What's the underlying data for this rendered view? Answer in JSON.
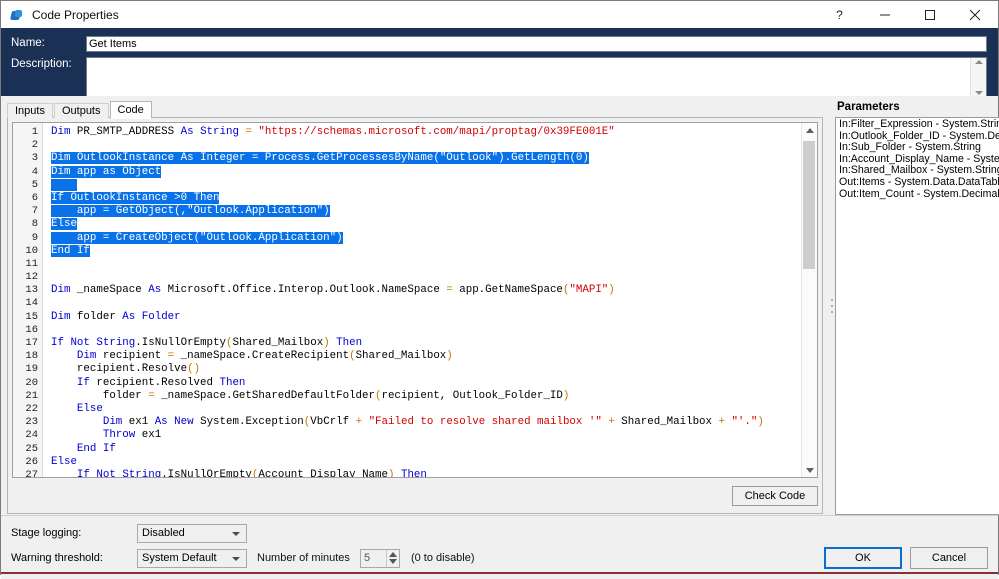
{
  "window": {
    "title": "Code Properties",
    "icon": "blueprism-app-icon",
    "controls": {
      "help": "?",
      "minimize": "minimize-icon",
      "maximize": "maximize-icon",
      "close": "close-icon"
    }
  },
  "header": {
    "name_label": "Name:",
    "name_value": "Get Items",
    "description_label": "Description:",
    "description_value": "",
    "description_placeholder": ""
  },
  "tabs": [
    {
      "label": "Inputs",
      "active": false
    },
    {
      "label": "Outputs",
      "active": false
    },
    {
      "label": "Code",
      "active": true
    }
  ],
  "editor": {
    "check_code_label": "Check Code",
    "selected_lines": [
      3,
      4,
      5,
      6,
      7,
      8,
      9,
      10
    ],
    "first_visible_line": 1,
    "last_visible_line": 27,
    "lines": [
      {
        "n": 1,
        "text": "Dim PR_SMTP_ADDRESS As String = \"https://schemas.microsoft.com/mapi/proptag/0x39FE001E\""
      },
      {
        "n": 2,
        "text": ""
      },
      {
        "n": 3,
        "text": "Dim OutlookInstance As Integer = Process.GetProcessesByName(\"Outlook\").GetLength(0)"
      },
      {
        "n": 4,
        "text": "Dim app as Object"
      },
      {
        "n": 5,
        "text": ""
      },
      {
        "n": 6,
        "text": "If OutlookInstance >0 Then"
      },
      {
        "n": 7,
        "text": "    app = GetObject(,\"Outlook.Application\")"
      },
      {
        "n": 8,
        "text": "Else"
      },
      {
        "n": 9,
        "text": "    app = CreateObject(\"Outlook.Application\")"
      },
      {
        "n": 10,
        "text": "End If"
      },
      {
        "n": 11,
        "text": ""
      },
      {
        "n": 12,
        "text": ""
      },
      {
        "n": 13,
        "text": "Dim _nameSpace As Microsoft.Office.Interop.Outlook.NameSpace = app.GetNameSpace(\"MAPI\")"
      },
      {
        "n": 14,
        "text": ""
      },
      {
        "n": 15,
        "text": "Dim folder As Folder"
      },
      {
        "n": 16,
        "text": ""
      },
      {
        "n": 17,
        "text": "If Not String.IsNullOrEmpty(Shared_Mailbox) Then"
      },
      {
        "n": 18,
        "text": "    Dim recipient = _nameSpace.CreateRecipient(Shared_Mailbox)"
      },
      {
        "n": 19,
        "text": "    recipient.Resolve()"
      },
      {
        "n": 20,
        "text": "    If recipient.Resolved Then"
      },
      {
        "n": 21,
        "text": "        folder = _nameSpace.GetSharedDefaultFolder(recipient, Outlook_Folder_ID)"
      },
      {
        "n": 22,
        "text": "    Else"
      },
      {
        "n": 23,
        "text": "        Dim ex1 As New System.Exception(VbCrlf + \"Failed to resolve shared mailbox '\" + Shared_Mailbox + \"'.\")"
      },
      {
        "n": 24,
        "text": "        Throw ex1"
      },
      {
        "n": 25,
        "text": "    End If"
      },
      {
        "n": 26,
        "text": "Else"
      },
      {
        "n": 27,
        "text": "    If Not String.IsNullOrEmpty(Account_Display_Name) Then"
      }
    ]
  },
  "parameters": {
    "title": "Parameters",
    "items": [
      "In:Filter_Expression - System.String",
      "In:Outlook_Folder_ID - System.Decimal",
      "In:Sub_Folder - System.String",
      "In:Account_Display_Name - System.String",
      "In:Shared_Mailbox - System.String",
      "Out:Items - System.Data.DataTable",
      "Out:Item_Count - System.Decimal"
    ]
  },
  "footer": {
    "stage_logging_label": "Stage logging:",
    "stage_logging_value": "Disabled",
    "warning_threshold_label": "Warning threshold:",
    "warning_threshold_value": "System Default",
    "minutes_label": "Number of minutes",
    "minutes_value": "5",
    "minutes_hint": "(0 to disable)",
    "ok_label": "OK",
    "cancel_label": "Cancel"
  },
  "colors": {
    "header_bg": "#1b3055",
    "selection_blue": "#0a72e8",
    "keyword_blue": "#0000d0",
    "string_red": "#d40000",
    "operator_orange": "#c07800",
    "ok_focus_border": "#0a6ed1",
    "accent_maroon": "#8b3030"
  }
}
